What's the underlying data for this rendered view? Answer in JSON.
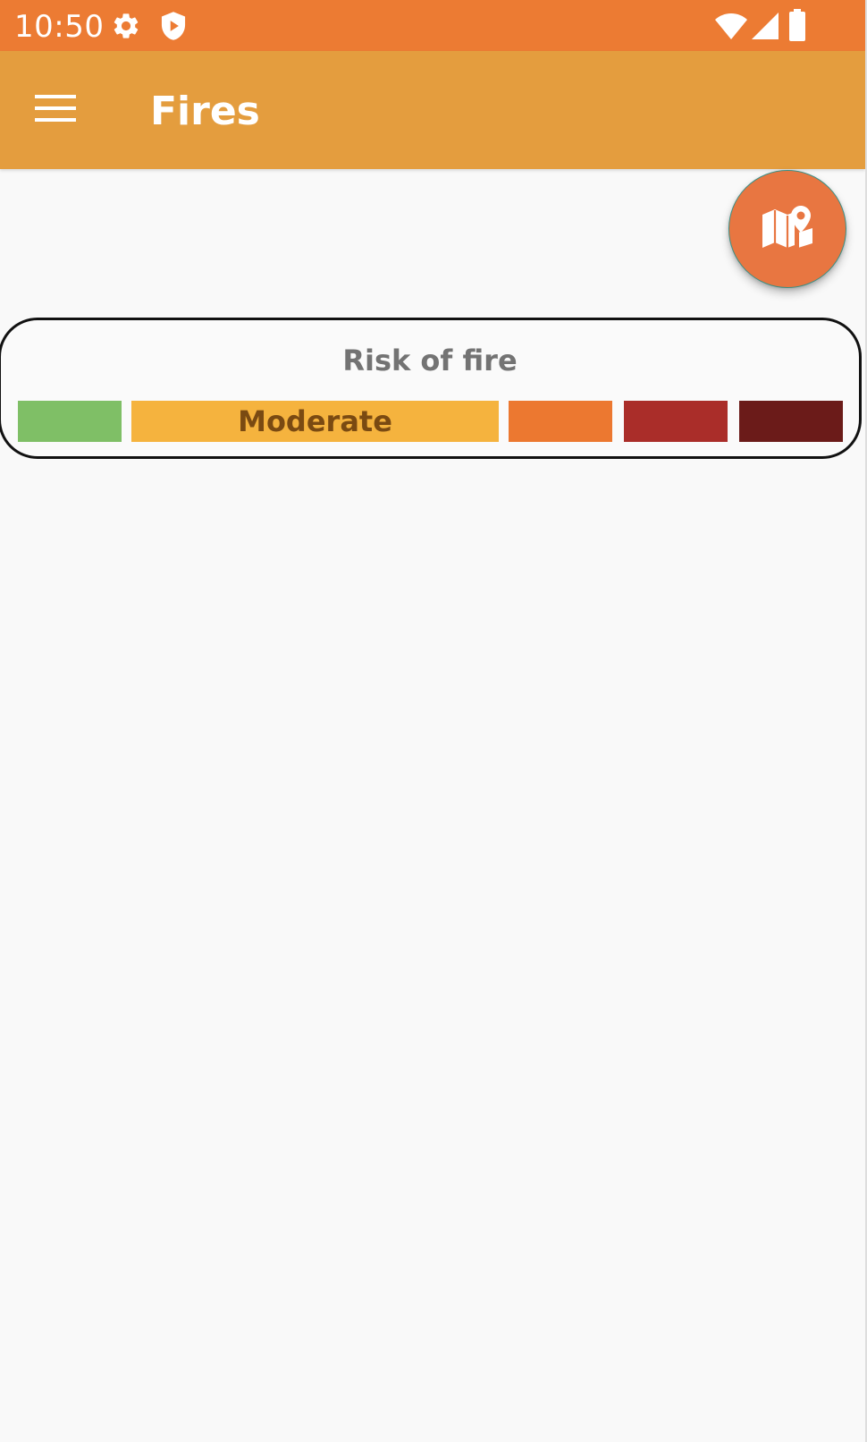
{
  "status_bar": {
    "time": "10:50",
    "icons": [
      "settings-icon",
      "shield-play-icon",
      "wifi-icon",
      "signal-icon",
      "battery-icon"
    ]
  },
  "app_bar": {
    "title": "Fires",
    "menu_icon": "menu-icon"
  },
  "fab": {
    "icon": "map-pin-icon"
  },
  "risk": {
    "title": "Risk of fire",
    "levels": [
      {
        "label": "",
        "color": "#7fbf66"
      },
      {
        "label": "Moderate",
        "color": "#f5b33e",
        "selected": true
      },
      {
        "label": "",
        "color": "#ec7830"
      },
      {
        "label": "",
        "color": "#aa2d29"
      },
      {
        "label": "",
        "color": "#6b1b19"
      }
    ]
  },
  "colors": {
    "status_bar": "#ec7b33",
    "app_bar": "#e49d3e",
    "fab": "#e87641",
    "background": "#f9f9f9"
  }
}
